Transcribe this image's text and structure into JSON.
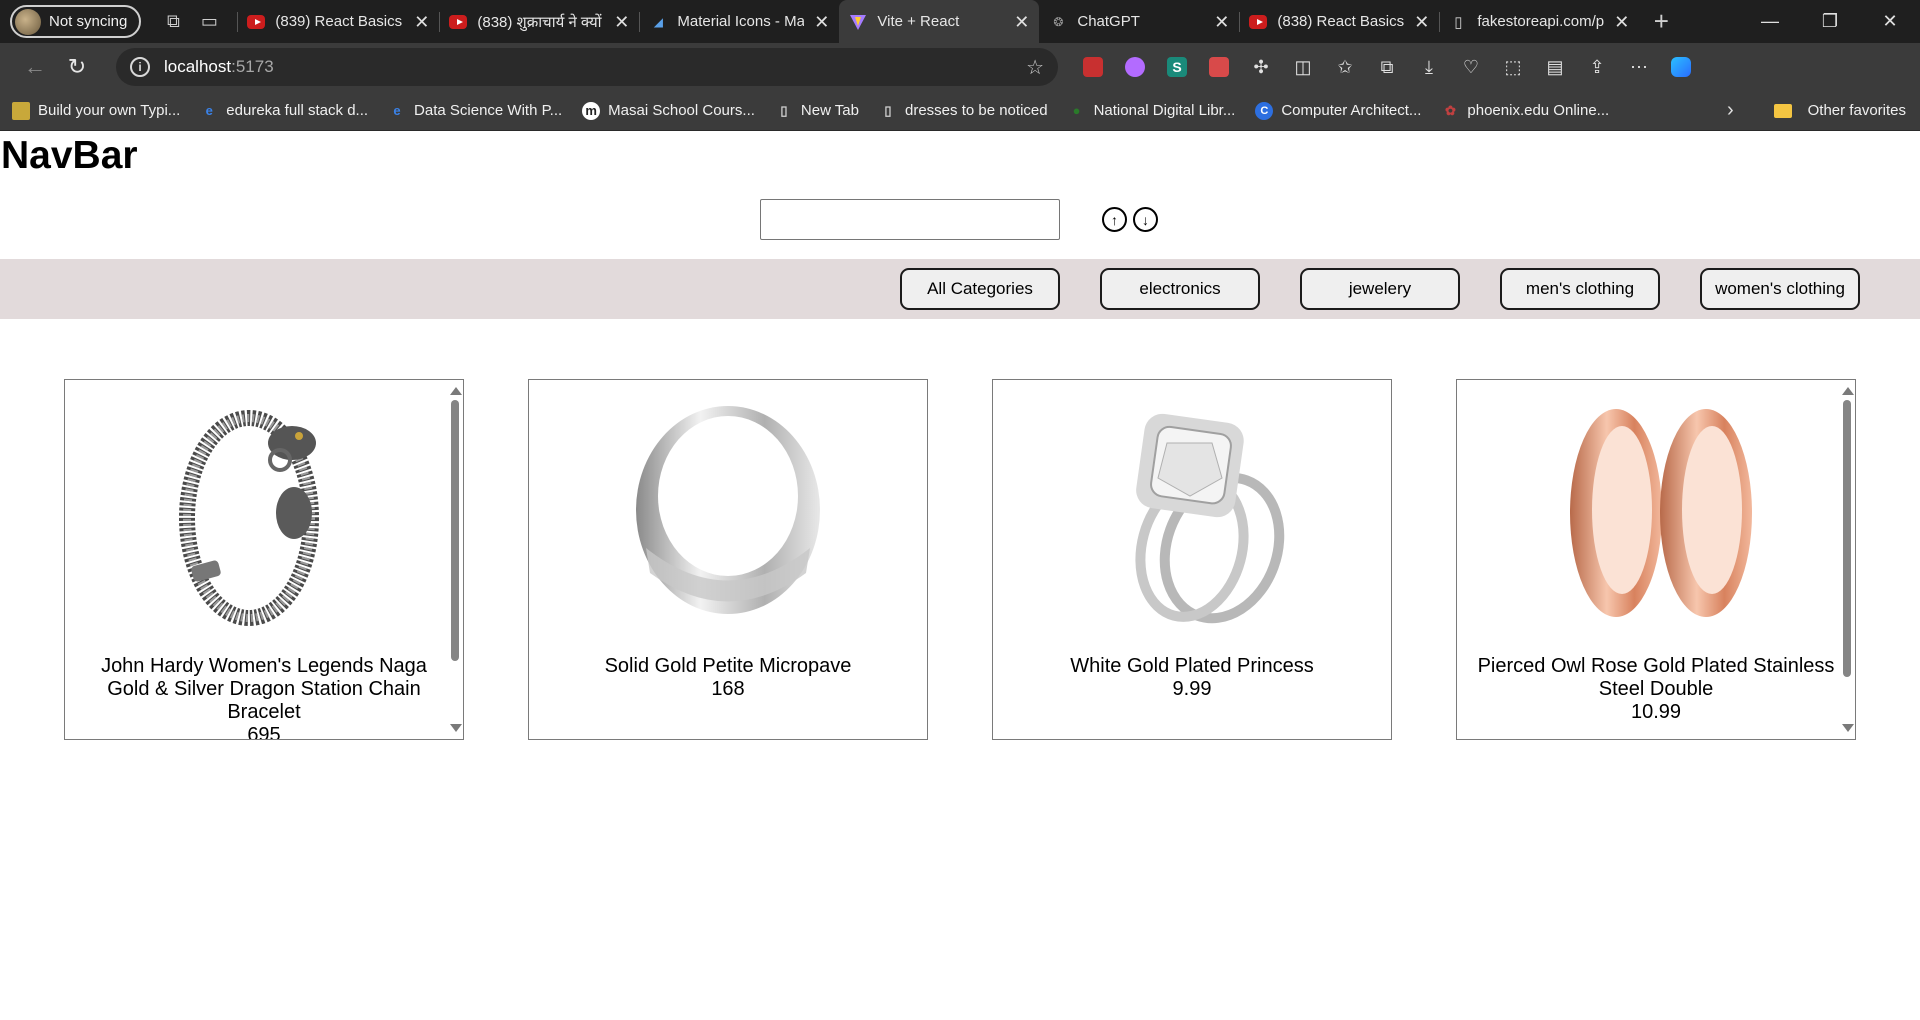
{
  "browser": {
    "profile_label": "Not syncing",
    "tabs": [
      {
        "title": "(839) React Basics |",
        "icon": "youtube-icon"
      },
      {
        "title": "(838) शुक्राचार्य ने क्यों",
        "icon": "youtube-icon"
      },
      {
        "title": "Material Icons - Ma",
        "icon": "material-icon"
      },
      {
        "title": "Vite + React",
        "icon": "vite-icon",
        "active": true
      },
      {
        "title": "ChatGPT",
        "icon": "chatgpt-icon"
      },
      {
        "title": "(838) React Basics |",
        "icon": "youtube-icon"
      },
      {
        "title": "fakestoreapi.com/p",
        "icon": "page-icon"
      }
    ],
    "address": {
      "host": "localhost",
      "port": ":5173"
    },
    "bookmarks": [
      {
        "label": "Build your own Typi...",
        "color": "#c8a83a"
      },
      {
        "label": "edureka full stack d...",
        "color": "#1e5fbf",
        "glyph": "e"
      },
      {
        "label": "Data Science With P...",
        "color": "#1e5fbf",
        "glyph": "e"
      },
      {
        "label": "Masai School Cours...",
        "color": "#ffffff",
        "glyph": "m"
      },
      {
        "label": "New Tab",
        "color": "#d0d0d0",
        "glyph": "▯"
      },
      {
        "label": "dresses to be noticed",
        "color": "#d0d0d0",
        "glyph": "▯"
      },
      {
        "label": "National Digital Libr...",
        "color": "#2a7a2a",
        "glyph": "●"
      },
      {
        "label": "Computer Architect...",
        "color": "#2d6fe0",
        "glyph": "C"
      },
      {
        "label": "phoenix.edu Online...",
        "color": "#b03030",
        "glyph": "✿"
      }
    ],
    "other_favorites": "Other favorites"
  },
  "page": {
    "title": "NavBar",
    "search": {
      "value": "",
      "placeholder": ""
    },
    "sort_up_icon": "arrow-up-circle-icon",
    "sort_down_icon": "arrow-down-circle-icon",
    "categories": [
      "All Categories",
      "electronics",
      "jewelery",
      "men's clothing",
      "women's clothing"
    ],
    "products": [
      {
        "title": "John Hardy Women's Legends Naga Gold & Silver Dragon Station Chain Bracelet",
        "price": "695",
        "image": "bracelet",
        "scroll_thumb_fraction": 0.83
      },
      {
        "title": "Solid Gold Petite Micropave",
        "price": "168",
        "image": "silver-ring"
      },
      {
        "title": "White Gold Plated Princess",
        "price": "9.99",
        "image": "diamond-ring"
      },
      {
        "title": "Pierced Owl Rose Gold Plated Stainless Steel Double",
        "price": "10.99",
        "image": "rose-gold-plugs",
        "scroll_thumb_fraction": 0.88
      }
    ]
  }
}
